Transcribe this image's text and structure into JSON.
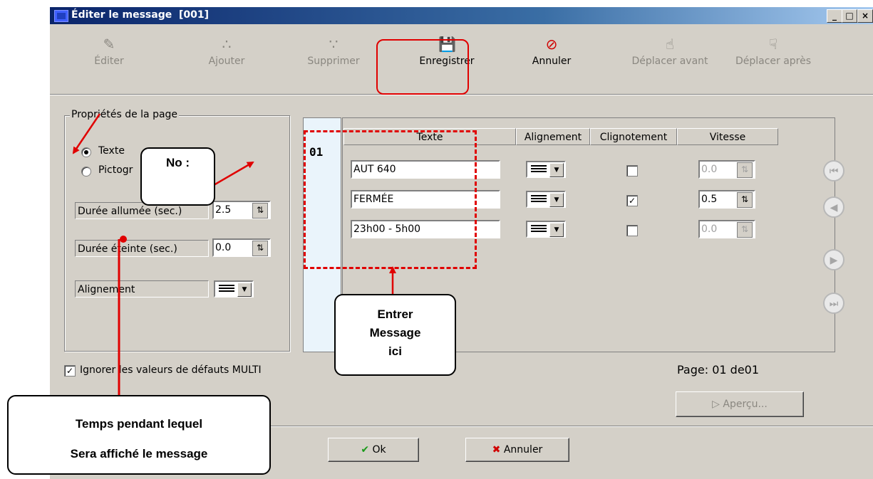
{
  "window": {
    "title": "Éditer le message  [001]",
    "controls": {
      "minimize": "_",
      "maximize": "□",
      "close": "×"
    }
  },
  "toolbar": {
    "edit": "Éditer",
    "add": "Ajouter",
    "delete": "Supprimer",
    "save": "Enregistrer",
    "cancel": "Annuler",
    "move_before": "Déplacer avant",
    "move_after": "Déplacer après"
  },
  "page_properties": {
    "legend": "Propriétés de la page",
    "radio_text": "Texte",
    "radio_pictogram": "Pictogr",
    "on_duration_label": "Durée allumée (sec.)",
    "on_duration_value": "2.5",
    "off_duration_label": "Durée éteinte (sec.)",
    "off_duration_value": "0.0",
    "alignment_label": "Alignement"
  },
  "page_list": {
    "current": "01"
  },
  "grid": {
    "headers": {
      "text": "Texte",
      "alignment": "Alignement",
      "blink": "Clignotement",
      "speed": "Vitesse"
    },
    "rows": [
      {
        "text": "AUT 640",
        "blink": false,
        "speed": "0.0",
        "speed_enabled": false
      },
      {
        "text": "FERMÉE",
        "blink": true,
        "speed": "0.5",
        "speed_enabled": true
      },
      {
        "text": "23h00 - 5h00",
        "blink": false,
        "speed": "0.0",
        "speed_enabled": false
      }
    ]
  },
  "ignore_defaults_label": "Ignorer les valeurs de défauts MULTI",
  "page_indicator": {
    "label": "Page:",
    "current": "01",
    "of": "de",
    "total": "01"
  },
  "preview_button": "Aperçu...",
  "ok_button": "Ok",
  "cancel_button": "Annuler",
  "annotations": {
    "no_label": "No :",
    "enter_message_1": "Entrer",
    "enter_message_2": "Message",
    "enter_message_3": "ici",
    "time_1": "Temps pendant lequel",
    "time_2": "Sera affiché le message"
  },
  "colors": {
    "annotation_red": "#e00000",
    "title_bar": "#0a246a",
    "dialog_bg": "#d4d0c8"
  }
}
